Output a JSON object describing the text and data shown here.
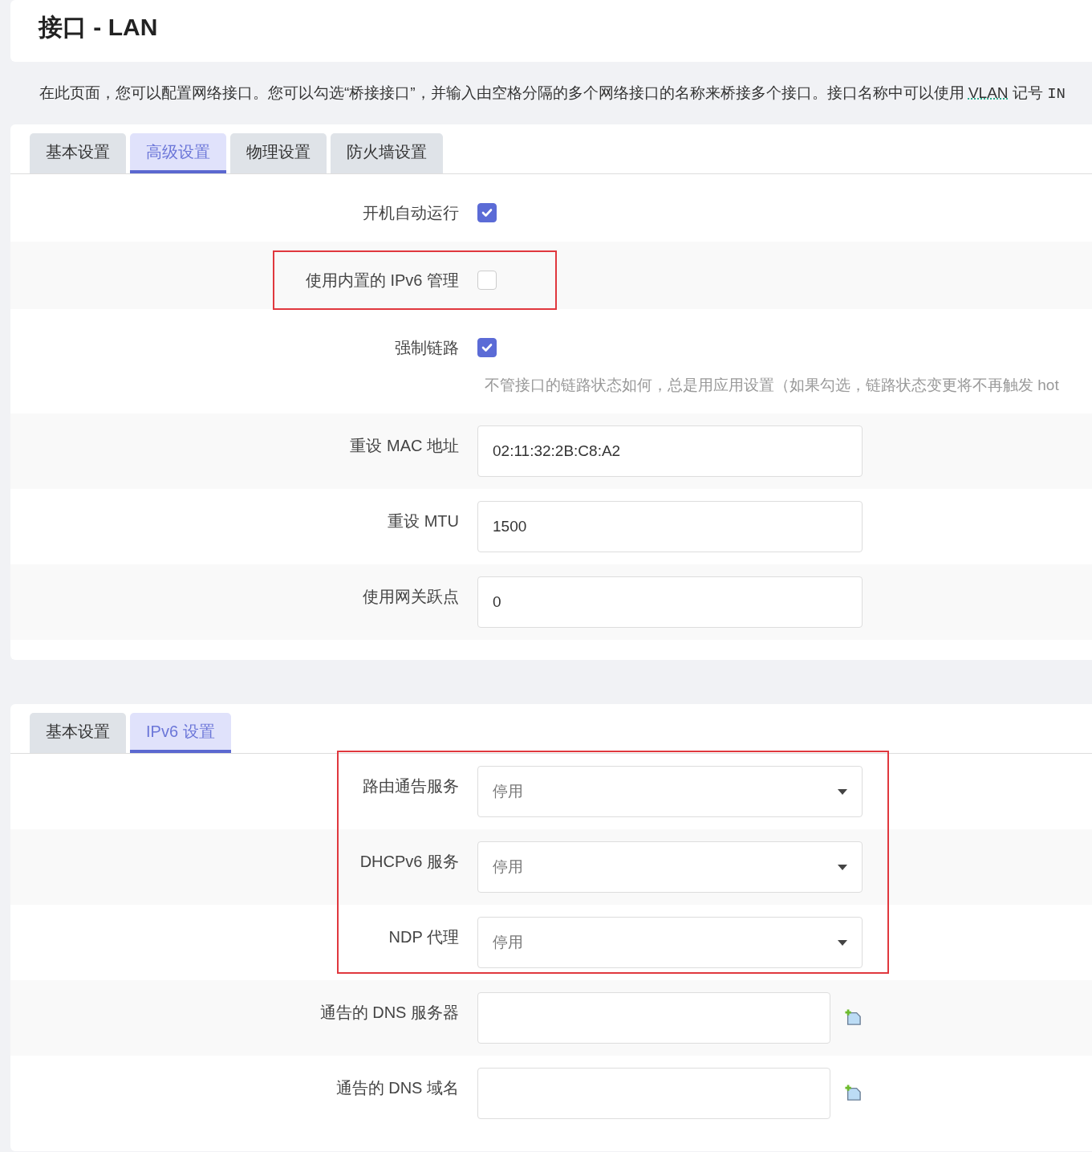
{
  "page_title": "接口 - LAN",
  "description_parts": [
    {
      "kind": "text",
      "text": "在此页面，您可以配置网络接口。您可以勾选“桥接接口”，并输入由空格分隔的多个网络接口的名称来桥接多个接口。接口名称中可以使用 "
    },
    {
      "kind": "abbr",
      "text": "VLAN"
    },
    {
      "kind": "text",
      "text": " 记号 "
    },
    {
      "kind": "mono",
      "text": "IN"
    }
  ],
  "sections": [
    {
      "tabs": [
        {
          "label": "基本设置",
          "selected": false
        },
        {
          "label": "高级设置",
          "selected": true
        },
        {
          "label": "物理设置",
          "selected": false
        },
        {
          "label": "防火墙设置",
          "selected": false
        }
      ],
      "rows": [
        {
          "kind": "checkbox",
          "label": "开机自动运行",
          "checked": true,
          "highlighted": false
        },
        {
          "kind": "checkbox",
          "label": "使用内置的 IPv6 管理",
          "checked": false,
          "highlighted": true
        },
        {
          "kind": "checkbox",
          "label": "强制链路",
          "checked": true,
          "highlighted": false,
          "hint": "不管接口的链路状态如何，总是用应用设置（如果勾选，链路状态变更将不再触发 hot"
        },
        {
          "kind": "text",
          "label": "重设 MAC 地址",
          "value": "02:11:32:2B:C8:A2",
          "highlighted": false
        },
        {
          "kind": "text",
          "label": "重设 MTU",
          "value": "1500",
          "highlighted": false
        },
        {
          "kind": "text",
          "label": "使用网关跃点",
          "value": "0",
          "highlighted": false
        }
      ]
    },
    {
      "tabs": [
        {
          "label": "基本设置",
          "selected": false
        },
        {
          "label": "IPv6 设置",
          "selected": true
        }
      ],
      "rows": [
        {
          "kind": "select",
          "label": "路由通告服务",
          "value": "停用",
          "highlighted": true
        },
        {
          "kind": "select",
          "label": "DHCPv6 服务",
          "value": "停用",
          "highlighted": true
        },
        {
          "kind": "select",
          "label": "NDP 代理",
          "value": "停用",
          "highlighted": true
        },
        {
          "kind": "list",
          "label": "通告的 DNS 服务器",
          "highlighted": false
        },
        {
          "kind": "list",
          "label": "通告的 DNS 域名",
          "highlighted": false
        }
      ]
    }
  ]
}
